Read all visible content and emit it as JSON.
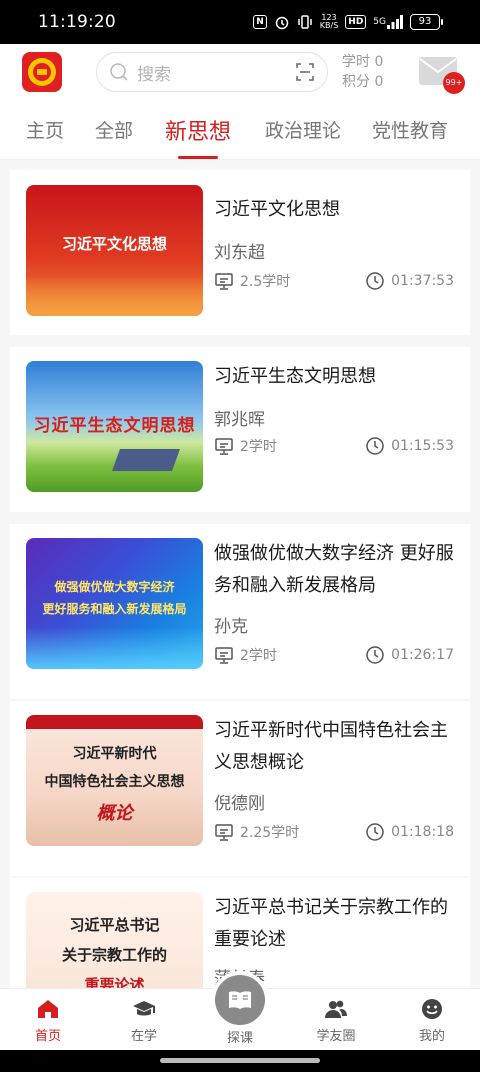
{
  "status_bar": {
    "time": "11:19:20",
    "nfc": "N",
    "speed_value": "123",
    "speed_unit": "KB/S",
    "hd": "HD",
    "network": "5G",
    "battery": "93"
  },
  "header": {
    "search_placeholder": "搜索",
    "study_hours_label": "学时 0",
    "points_label": "积分 0",
    "mail_badge": "99+"
  },
  "tabs": [
    {
      "label": "主页"
    },
    {
      "label": "全部"
    },
    {
      "label": "新思想",
      "active": true
    },
    {
      "label": "政治理论"
    },
    {
      "label": "党性教育"
    }
  ],
  "courses": [
    {
      "thumb_text": "习近平文化思想",
      "title": "习近平文化思想",
      "author": "刘东超",
      "hours": "2.5学时",
      "duration": "01:37:53"
    },
    {
      "thumb_text": "习近平生态文明思想",
      "title": "习近平生态文明思想",
      "author": "郭兆晖",
      "hours": "2学时",
      "duration": "01:15:53"
    },
    {
      "thumb_text_line1": "做强做优做大数字经济",
      "thumb_text_line2": "更好服务和融入新发展格局",
      "title": "做强做优做大数字经济 更好服务和融入新发展格局",
      "author": "孙克",
      "hours": "2学时",
      "duration": "01:26:17"
    },
    {
      "thumb_text_line1": "习近平新时代",
      "thumb_text_line2": "中国特色社会主义思想",
      "thumb_text_line3": "概论",
      "title": "习近平新时代中国特色社会主义思想概论",
      "author": "倪德刚",
      "hours": "2.25学时",
      "duration": "01:18:18"
    },
    {
      "thumb_text_line1": "习近平总书记",
      "thumb_text_line2": "关于宗教工作的",
      "thumb_text_line3": "重要论述",
      "title": "习近平总书记关于宗教工作的重要论述",
      "author": "蒲长春"
    }
  ],
  "bottom_nav": [
    {
      "label": "首页",
      "icon": "home-icon",
      "active": true
    },
    {
      "label": "在学",
      "icon": "graduation-cap-icon"
    },
    {
      "label": "探课",
      "icon": "book-icon"
    },
    {
      "label": "学友圈",
      "icon": "people-icon"
    },
    {
      "label": "我的",
      "icon": "smiley-icon"
    }
  ],
  "colors": {
    "accent": "#d61e1e",
    "logo_yellow": "#f7c600"
  }
}
